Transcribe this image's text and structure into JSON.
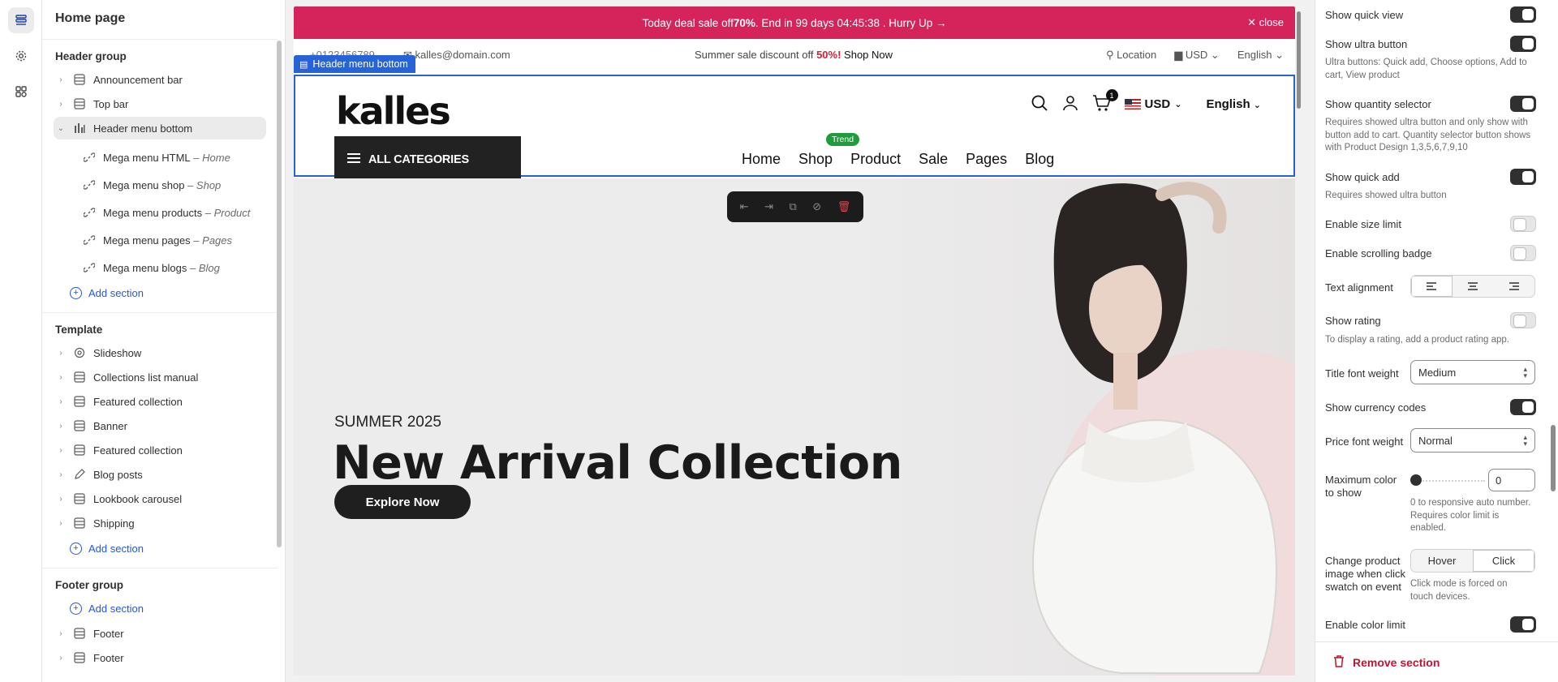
{
  "sidebar": {
    "title": "Home page",
    "header_group": {
      "label": "Header group",
      "items": [
        {
          "label": "Announcement bar"
        },
        {
          "label": "Top bar"
        },
        {
          "label": "Header menu bottom"
        }
      ],
      "children": [
        {
          "label": "Mega menu HTML",
          "sub": "Home"
        },
        {
          "label": "Mega menu shop",
          "sub": "Shop"
        },
        {
          "label": "Mega menu products",
          "sub": "Product"
        },
        {
          "label": "Mega menu pages",
          "sub": "Pages"
        },
        {
          "label": "Mega menu blogs",
          "sub": "Blog"
        }
      ],
      "add_label": "Add section"
    },
    "template": {
      "label": "Template",
      "items": [
        {
          "label": "Slideshow"
        },
        {
          "label": "Collections list manual"
        },
        {
          "label": "Featured collection"
        },
        {
          "label": "Banner"
        },
        {
          "label": "Featured collection"
        },
        {
          "label": "Blog posts"
        },
        {
          "label": "Lookbook carousel"
        },
        {
          "label": "Shipping"
        }
      ],
      "add_label": "Add section"
    },
    "footer_group": {
      "label": "Footer group",
      "add_label": "Add section",
      "items": [
        {
          "label": "Footer"
        },
        {
          "label": "Footer"
        }
      ]
    },
    "separator": " – "
  },
  "preview": {
    "announcement": {
      "pre": "Today deal sale off ",
      "bold": "70%",
      "post": ". End in 99 days 04:45:38 .  Hurry Up →",
      "close": "close"
    },
    "topbar": {
      "phone": "+0123456789",
      "email": "kalles@domain.com",
      "center_pre": "Summer sale discount off ",
      "center_red": "50%!",
      "center_link": "Shop Now",
      "location": "Location",
      "currency": "USD",
      "language": "English"
    },
    "selection_tag": "Header menu bottom",
    "header": {
      "logo": "kalles",
      "cart_count": "1",
      "currency": "USD",
      "language": "English",
      "categories": "ALL CATEGORIES",
      "trend_badge": "Trend",
      "nav": [
        "Home",
        "Shop",
        "Product",
        "Sale",
        "Pages",
        "Blog"
      ]
    },
    "hero": {
      "season": "SUMMER 2025",
      "title": "New Arrival Collection",
      "button": "Explore Now"
    }
  },
  "settings": {
    "show_quick_view": {
      "label": "Show quick view",
      "on": true
    },
    "show_ultra_button": {
      "label": "Show ultra button",
      "on": true,
      "help": "Ultra buttons: Quick add, Choose options, Add to cart, View product"
    },
    "show_quantity_selector": {
      "label": "Show quantity selector",
      "on": true,
      "help": "Requires showed ultra button and only show with button add to cart. Quantity selector button shows with Product Design 1,3,5,6,7,9,10"
    },
    "show_quick_add": {
      "label": "Show quick add",
      "on": true,
      "help": "Requires showed ultra button"
    },
    "enable_size_limit": {
      "label": "Enable size limit",
      "on": false
    },
    "enable_scrolling_badge": {
      "label": "Enable scrolling badge",
      "on": false
    },
    "text_alignment": {
      "label": "Text alignment"
    },
    "show_rating": {
      "label": "Show rating",
      "on": false,
      "help": "To display a rating, add a product rating app."
    },
    "title_font_weight": {
      "label": "Title font weight",
      "value": "Medium"
    },
    "show_currency_codes": {
      "label": "Show currency codes",
      "on": true
    },
    "price_font_weight": {
      "label": "Price font weight",
      "value": "Normal"
    },
    "max_color": {
      "label_1": "Maximum color",
      "label_2": "to show",
      "value": "0",
      "help_1": "0 to responsive auto number.",
      "help_2": "Requires color limit is",
      "help_3": "enabled."
    },
    "change_image": {
      "label_1": "Change product",
      "label_2": "image when click",
      "label_3": "swatch on event",
      "options": [
        "Hover",
        "Click"
      ],
      "selected": "Click",
      "help_1": "Click mode is forced on",
      "help_2": "touch devices."
    },
    "enable_color_limit": {
      "label": "Enable color limit",
      "on": true
    },
    "remove_section": "Remove section"
  },
  "colors": {
    "announcement_bg": "#d5245c",
    "accent_blue": "#2663d9",
    "trend_green": "#1e9c3c",
    "remove_red": "#c4122f"
  }
}
